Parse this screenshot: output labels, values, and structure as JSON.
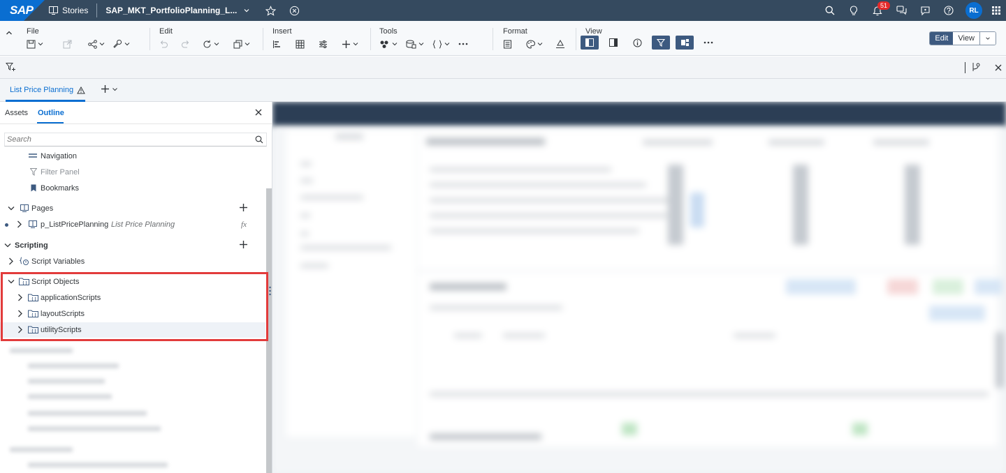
{
  "shell": {
    "logo": "SAP",
    "stories_label": "Stories",
    "title": "SAP_MKT_PortfolioPlanning_L...",
    "notification_count": "51",
    "avatar_initials": "RL",
    "icons": [
      "search-icon",
      "lightbulb-icon",
      "bell-icon",
      "chat-icon",
      "feedback-icon",
      "help-icon",
      "grid-menu-icon"
    ]
  },
  "toolbar": {
    "groups": {
      "file": "File",
      "edit": "Edit",
      "insert": "Insert",
      "tools": "Tools",
      "format": "Format",
      "view": "View"
    },
    "mode": {
      "edit": "Edit",
      "view": "View"
    }
  },
  "page_tabs": {
    "active": "List Price Planning"
  },
  "left_panel": {
    "tabs": {
      "assets": "Assets",
      "outline": "Outline"
    },
    "search_placeholder": "Search",
    "rows": {
      "navigation": "Navigation",
      "filter_panel": "Filter Panel",
      "bookmarks": "Bookmarks",
      "pages": "Pages",
      "page_item": "p_ListPricePlanning",
      "page_item_desc": "List Price Planning",
      "fx": "fx",
      "scripting": "Scripting",
      "script_variables": "Script Variables",
      "script_objects": "Script Objects",
      "application_scripts": "applicationScripts",
      "layout_scripts": "layoutScripts",
      "utility_scripts": "utilityScripts"
    }
  },
  "colors": {
    "shell_bg": "#354a5f",
    "accent": "#0a6ed1",
    "highlight_box": "#e23b3b",
    "selected_button": "#3d5a80"
  }
}
